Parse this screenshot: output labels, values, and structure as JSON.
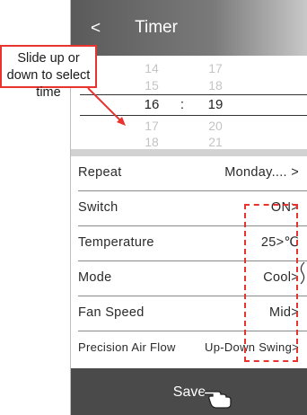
{
  "header": {
    "back_label": "<",
    "title": "Timer"
  },
  "picker": {
    "hours": [
      "14",
      "15",
      "16",
      "17",
      "18"
    ],
    "minutes": [
      "17",
      "18",
      "19",
      "20",
      "21"
    ],
    "separator": ":",
    "selected_hour": "16",
    "selected_minute": "19"
  },
  "settings": [
    {
      "label": "Repeat",
      "value": "Monday.... >"
    },
    {
      "label": "Switch",
      "value": "ON>"
    },
    {
      "label": "Temperature",
      "value": "25>℃"
    },
    {
      "label": "Mode",
      "value": "Cool>"
    },
    {
      "label": "Fan Speed",
      "value": "Mid>"
    },
    {
      "label": "Precision Air Flow",
      "value": "Up-Down Swing>"
    }
  ],
  "save_label": "Save",
  "annotation": "Slide up or down to select time",
  "colors": {
    "header_gradient": [
      "#5a5a5a",
      "#c9c9c9"
    ],
    "save_bar": "#4a4a4a",
    "annotation_red": "#e8332e"
  },
  "icons": [
    "back-chevron-icon",
    "pointing-hand-icon"
  ]
}
